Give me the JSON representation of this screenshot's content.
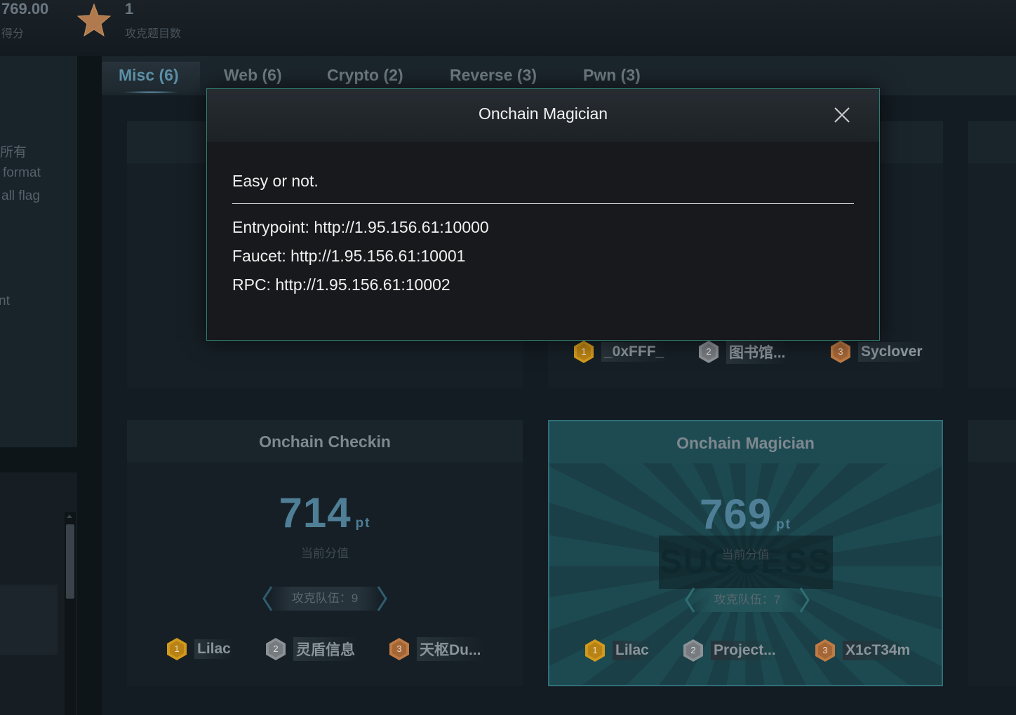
{
  "top_stats": {
    "score_value": "769.00",
    "score_label": "得分",
    "solved_value": "1",
    "solved_label": "攻克题目数"
  },
  "sidebar": {
    "text_lines": [
      "所有",
      "format",
      "all flag",
      "nt"
    ]
  },
  "tabs": [
    {
      "label": "Misc (6)",
      "active": true
    },
    {
      "label": "Web (6)",
      "active": false
    },
    {
      "label": "Crypto (2)",
      "active": false
    },
    {
      "label": "Reverse (3)",
      "active": false
    },
    {
      "label": "Pwn (3)",
      "active": false
    }
  ],
  "cards": {
    "top_right_winners": [
      "_0xFFF_",
      "图书馆...",
      "Syclover"
    ],
    "checkin": {
      "title": "Onchain Checkin",
      "points": "714",
      "unit": "pt",
      "points_label": "当前分值",
      "solves": "攻克队伍：9",
      "winners": [
        "Lilac",
        "灵盾信息",
        "天枢Du..."
      ]
    },
    "magician": {
      "title": "Onchain Magician",
      "points": "769",
      "unit": "pt",
      "points_label": "当前分值",
      "solves": "攻克队伍：7",
      "stamp": "SUCCESS",
      "winners": [
        "Lilac",
        "Project...",
        "X1cT34m"
      ]
    }
  },
  "medals": [
    "1",
    "2",
    "3"
  ],
  "colors": {
    "gold": "#d29a1c",
    "silver": "#8c9196",
    "bronze": "#c07a44",
    "accent": "#5b8fa6",
    "modal_border": "#2f7c72"
  },
  "modal": {
    "title": "Onchain Magician",
    "description": "Easy or not.",
    "lines": [
      "Entrypoint: http://1.95.156.61:10000",
      "Faucet: http://1.95.156.61:10001",
      "RPC: http://1.95.156.61:10002"
    ]
  },
  "icons": {
    "star": "star-icon",
    "close": "close-icon",
    "medal": "medal-icon"
  }
}
